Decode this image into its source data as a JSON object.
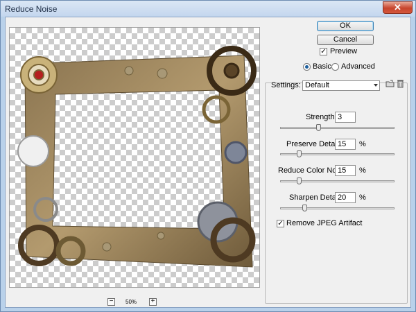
{
  "window": {
    "title": "Reduce Noise"
  },
  "buttons": {
    "ok": "OK",
    "cancel": "Cancel"
  },
  "preview": {
    "label": "Preview",
    "checked": true,
    "zoom": "50%",
    "zoom_out": "−",
    "zoom_in": "+"
  },
  "mode": {
    "basic": "Basic",
    "advanced": "Advanced",
    "selected": "Basic"
  },
  "settings": {
    "label": "Settings:",
    "value": "Default"
  },
  "controls": {
    "strength": {
      "label": "Strength:",
      "value": "3",
      "unit": "",
      "slider_fraction": 0.33
    },
    "preserve_details": {
      "label": "Preserve Details:",
      "value": "15",
      "unit": "%",
      "slider_fraction": 0.15
    },
    "reduce_color_noise": {
      "label": "Reduce Color Noise:",
      "value": "15",
      "unit": "%",
      "slider_fraction": 0.15
    },
    "sharpen_details": {
      "label": "Sharpen Details:",
      "value": "20",
      "unit": "%",
      "slider_fraction": 0.2
    }
  },
  "remove_jpeg": {
    "label": "Remove JPEG Artifact",
    "checked": true
  },
  "icons": {
    "close": "close-icon",
    "save_settings": "save-settings-icon",
    "delete_settings": "delete-settings-icon"
  }
}
